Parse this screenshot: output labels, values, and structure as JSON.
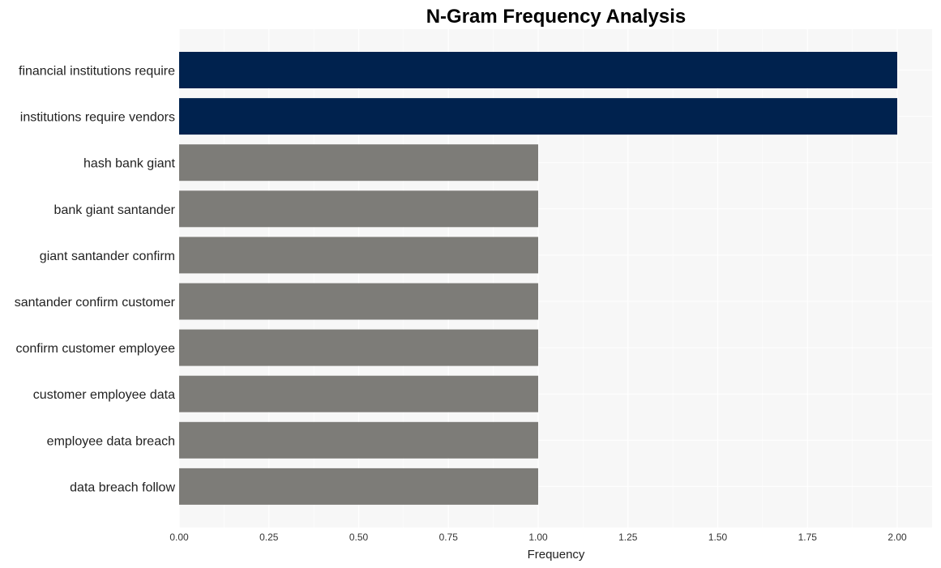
{
  "chart_data": {
    "type": "bar",
    "orientation": "horizontal",
    "title": "N-Gram Frequency Analysis",
    "xlabel": "Frequency",
    "ylabel": "",
    "xlim": [
      0,
      2.1
    ],
    "xticks": [
      0,
      0.25,
      0.5,
      0.75,
      1.0,
      1.25,
      1.5,
      1.75,
      2.0
    ],
    "xtick_labels": [
      "0.00",
      "0.25",
      "0.50",
      "0.75",
      "1.00",
      "1.25",
      "1.50",
      "1.75",
      "2.00"
    ],
    "grid": true,
    "legend": "none",
    "categories": [
      "financial institutions require",
      "institutions require vendors",
      "hash bank giant",
      "bank giant santander",
      "giant santander confirm",
      "santander confirm customer",
      "confirm customer employee",
      "customer employee data",
      "employee data breach",
      "data breach follow"
    ],
    "values": [
      2,
      2,
      1,
      1,
      1,
      1,
      1,
      1,
      1,
      1
    ],
    "colors": {
      "highlight": "#00224e",
      "default": "#7d7c78",
      "plot_background": "#f7f7f7",
      "grid": "#ffffff"
    }
  }
}
